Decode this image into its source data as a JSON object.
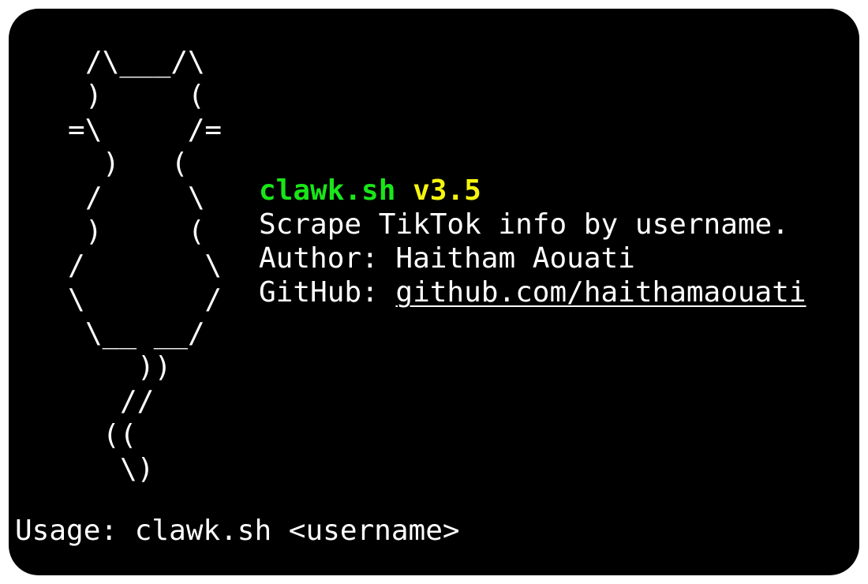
{
  "ascii_art": [
    "/\\___/\\",
    ")     (",
    "=\\     /=",
    ")   (",
    "/     \\",
    ")     (",
    "/       \\",
    "\\       /",
    "\\__ __/",
    "))",
    "//",
    "((",
    "\\)"
  ],
  "info": {
    "name": "clawk.sh",
    "version": "v3.5",
    "description": "Scrape TikTok info by username.",
    "author_label": "Author:",
    "author_value": "Haitham Aouati",
    "github_label": "GitHub:",
    "github_link": "github.com/haithamaouati"
  },
  "usage": {
    "label": "Usage:",
    "command": "clawk.sh <username>"
  },
  "colors": {
    "background": "#000000",
    "text": "#ffffff",
    "name": "#19e619",
    "version": "#f5f50f"
  }
}
